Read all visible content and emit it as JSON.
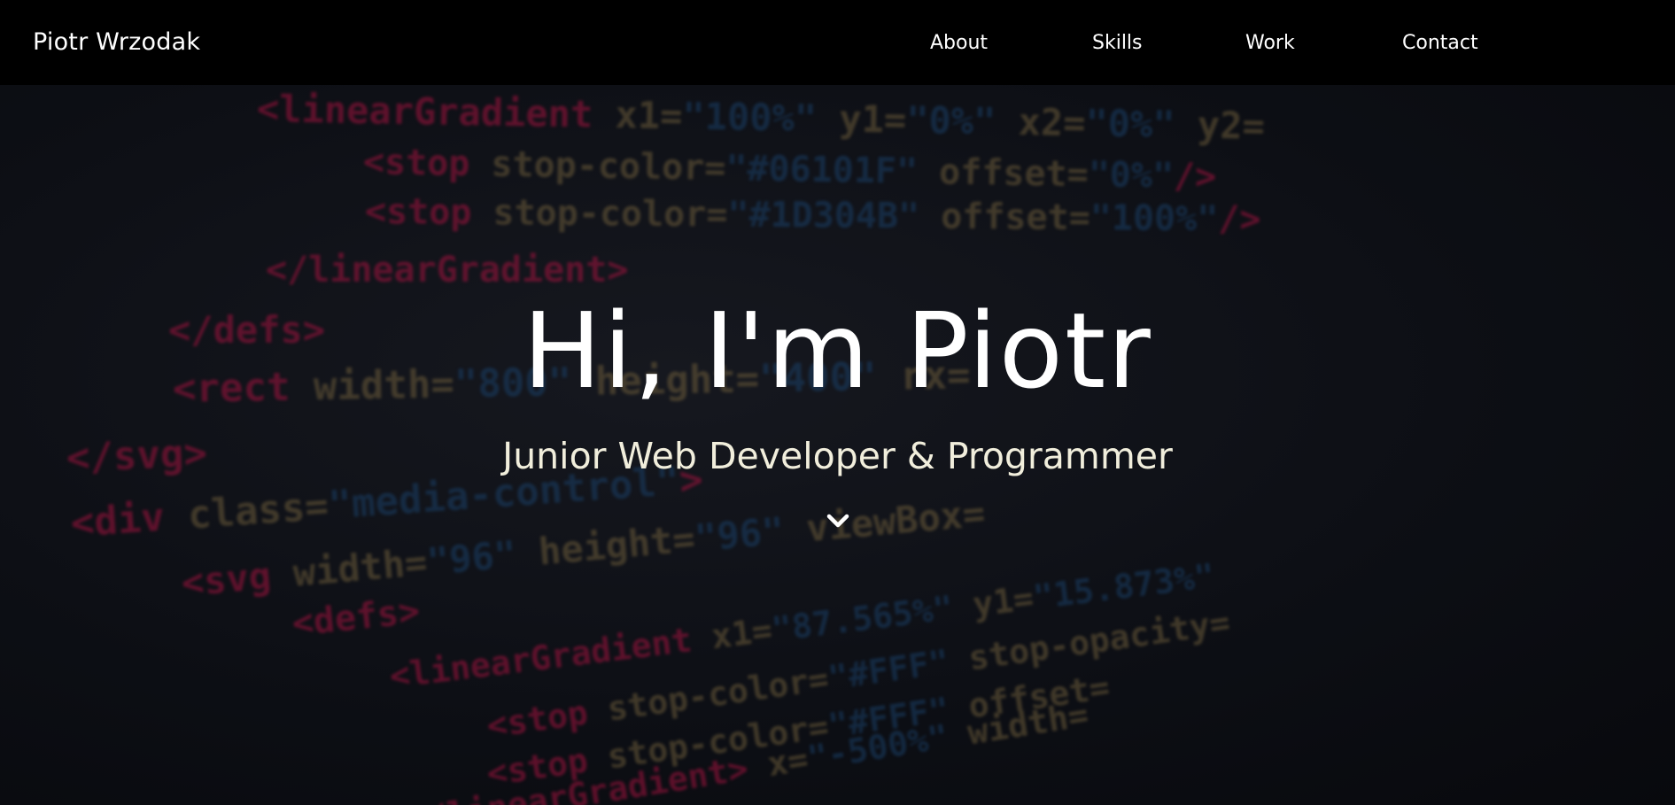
{
  "nav": {
    "brand": "Piotr Wrzodak",
    "links": [
      "About",
      "Skills",
      "Work",
      "Contact"
    ]
  },
  "hero": {
    "title": "Hi, I'm Piotr",
    "subtitle": "Junior Web Developer & Programmer",
    "scroll_icon": "chevron-down-icon"
  },
  "background_code": [
    [
      "<linearGradient",
      " x1=",
      "\"100%\"",
      " y1=",
      "\"0%\"",
      " x2=",
      "\"0%\"",
      " y2="
    ],
    [
      "<stop",
      " stop-color=",
      "\"#06101F\"",
      " offset=",
      "\"0%\"",
      "/>"
    ],
    [
      "<stop",
      " stop-color=",
      "\"#1D304B\"",
      " offset=",
      "\"100%\"",
      "/>"
    ],
    [
      "</linearGradient>"
    ],
    [
      "</defs>"
    ],
    [
      "<rect",
      " width=",
      "\"800\"",
      " height=",
      "\"400\"",
      " rx="
    ],
    [
      "</svg>"
    ],
    [
      "<div",
      " class=",
      "\"media-control\"",
      ">"
    ],
    [
      "<svg",
      " width=",
      "\"96\"",
      " height=",
      "\"96\"",
      " viewBox="
    ],
    [
      "<defs>"
    ],
    [
      "<linearGradient",
      " x1=",
      "\"87.565%\"",
      " y1=",
      "\"15.873%\""
    ],
    [
      "<stop",
      " stop-color=",
      "\"#FFF\"",
      " stop-opacity="
    ],
    [
      "<stop",
      " stop-color=",
      "\"#FFF\"",
      " offset="
    ],
    [
      "</linearGradient>",
      " x=",
      "\"-500%\"",
      " width="
    ]
  ],
  "colors": {
    "nav_bg": "#000000",
    "text": "#ffffff",
    "subtitle": "#f1eedc",
    "code_tag": "#a0133e",
    "code_attr": "#6b5b3a",
    "code_string": "#1a3f66"
  }
}
